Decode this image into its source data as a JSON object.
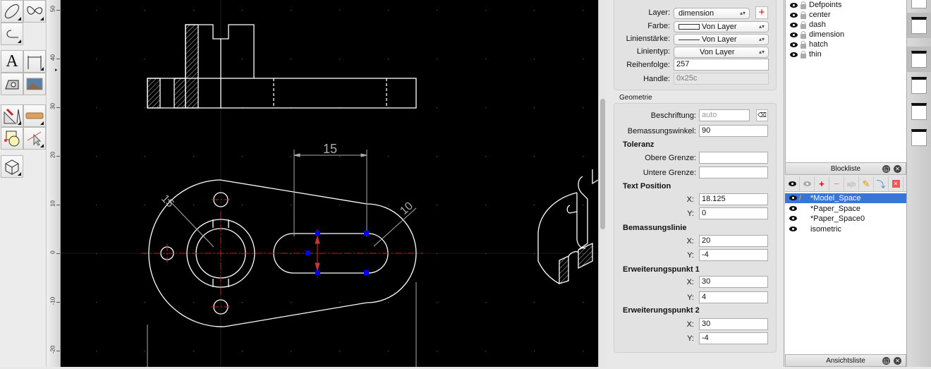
{
  "toolbar": {
    "tools": [
      "ellipse-tool",
      "spline-tool",
      "polyline-tool",
      "text-tool",
      "dimension-tool",
      "hatch-tool",
      "image-tool",
      "drafting-tools",
      "measure-tool",
      "modify-tool",
      "select-tool",
      "block-tool"
    ]
  },
  "ruler": {
    "labels": [
      "50",
      "40",
      "30",
      "20",
      "10",
      "0",
      "-10",
      "-20"
    ]
  },
  "drawing": {
    "dim_linear": "15",
    "dim_radius_left": "15",
    "dim_radius_right": "10",
    "colors": {
      "background": "#000000",
      "lines": "#ffffff",
      "centerline": "#cc2222",
      "grip": "#0000ff"
    }
  },
  "properties": {
    "layer_label": "Layer:",
    "layer_value": "dimension",
    "color_label": "Farbe:",
    "color_value": "Von Layer",
    "lineweight_label": "Linienstärke:",
    "lineweight_value": "Von Layer",
    "linetype_label": "Linientyp:",
    "linetype_value": "Von Layer",
    "order_label": "Reihenfolge:",
    "order_value": "257",
    "handle_label": "Handle:",
    "handle_value": "0x25c",
    "geometry_title": "Geometrie",
    "label_label": "Beschriftung:",
    "label_placeholder": "auto",
    "angle_label": "Bemassungswinkel:",
    "angle_value": "90",
    "tolerance": "Toleranz",
    "upper_label": "Obere Grenze:",
    "upper_value": "",
    "lower_label": "Untere Grenze:",
    "lower_value": "",
    "text_position": "Text Position",
    "tp_x": "18.125",
    "tp_y": "0",
    "dim_line": "Bemassungslinie",
    "dl_x": "20",
    "dl_y": "-4",
    "ext1": "Erweiterungspunkt 1",
    "e1_x": "30",
    "e1_y": "4",
    "ext2": "Erweiterungspunkt 2",
    "e2_x": "30",
    "e2_y": "-4",
    "x_label": "X:",
    "y_label": "Y:"
  },
  "layers": {
    "items": [
      "Defpoints",
      "center",
      "dash",
      "dimension",
      "hatch",
      "thin"
    ]
  },
  "blocks": {
    "title": "Blockliste",
    "items": [
      "*Model_Space",
      "*Paper_Space",
      "*Paper_Space0",
      "isometric"
    ],
    "selected": "*Model_Space"
  },
  "views": {
    "title": "Ansichtsliste"
  }
}
